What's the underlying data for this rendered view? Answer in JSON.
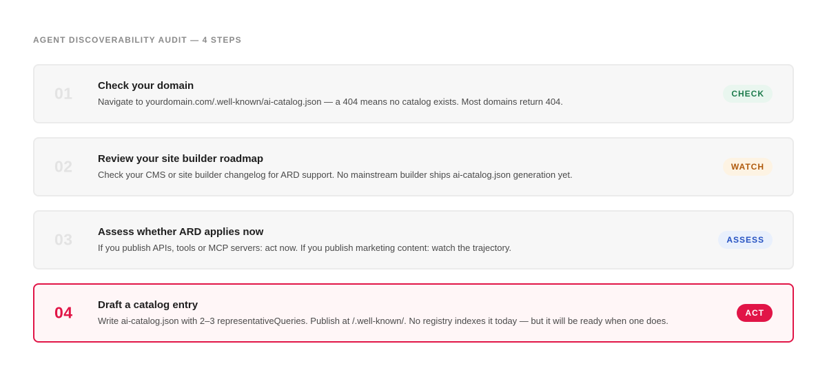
{
  "heading": "AGENT DISCOVERABILITY AUDIT — 4 STEPS",
  "steps": [
    {
      "number": "01",
      "title": "Check your domain",
      "description": "Navigate to yourdomain.com/.well-known/ai-catalog.json — a 404 means no catalog exists. Most domains return 404.",
      "badge": "CHECK"
    },
    {
      "number": "02",
      "title": "Review your site builder roadmap",
      "description": "Check your CMS or site builder changelog for ARD support. No mainstream builder ships ai-catalog.json generation yet.",
      "badge": "WATCH"
    },
    {
      "number": "03",
      "title": "Assess whether ARD applies now",
      "description": "If you publish APIs, tools or MCP servers: act now. If you publish marketing content: watch the trajectory.",
      "badge": "ASSESS"
    },
    {
      "number": "04",
      "title": "Draft a catalog entry",
      "description": "Write ai-catalog.json with 2–3 representativeQueries. Publish at /.well-known/. No registry indexes it today — but it will be ready when one does.",
      "badge": "ACT"
    }
  ],
  "colors": {
    "accent": "#e11547",
    "check": "#1d7b4c",
    "watch": "#b05a0c",
    "assess": "#2652c2"
  }
}
